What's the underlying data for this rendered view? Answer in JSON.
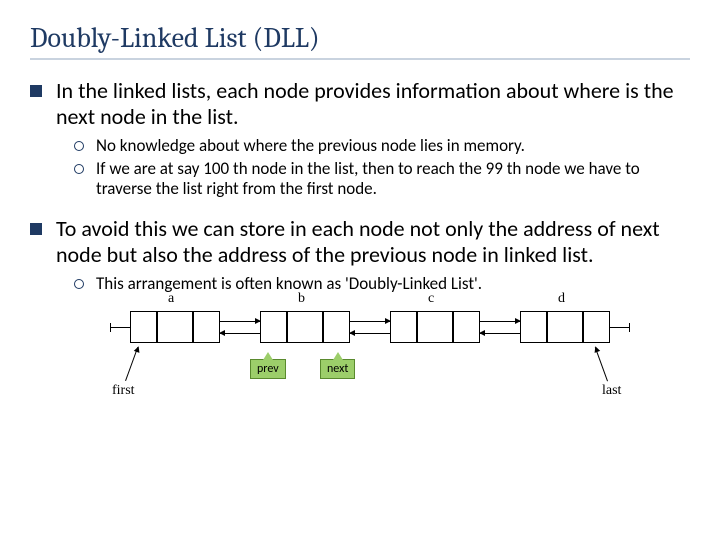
{
  "title": "Doubly-Linked List (DLL)",
  "bullets": {
    "b1": "In the linked lists, each node provides information about where is the next node in the list.",
    "b1_sub1": "No knowledge about where the previous node lies in memory.",
    "b1_sub2": "If we are at say 100 th node in the list, then to reach the 99 th node we have to traverse the list right from the first node.",
    "b2": "To avoid this we can store in each node not only the address of next node but also the address of the previous node in linked list.",
    "b2_sub1": "This arrangement is often known as 'Doubly-Linked List'."
  },
  "diagram": {
    "nodes": [
      "a",
      "b",
      "c",
      "d"
    ],
    "first_label": "first",
    "last_label": "last",
    "prev_label": "prev",
    "next_label": "next"
  }
}
